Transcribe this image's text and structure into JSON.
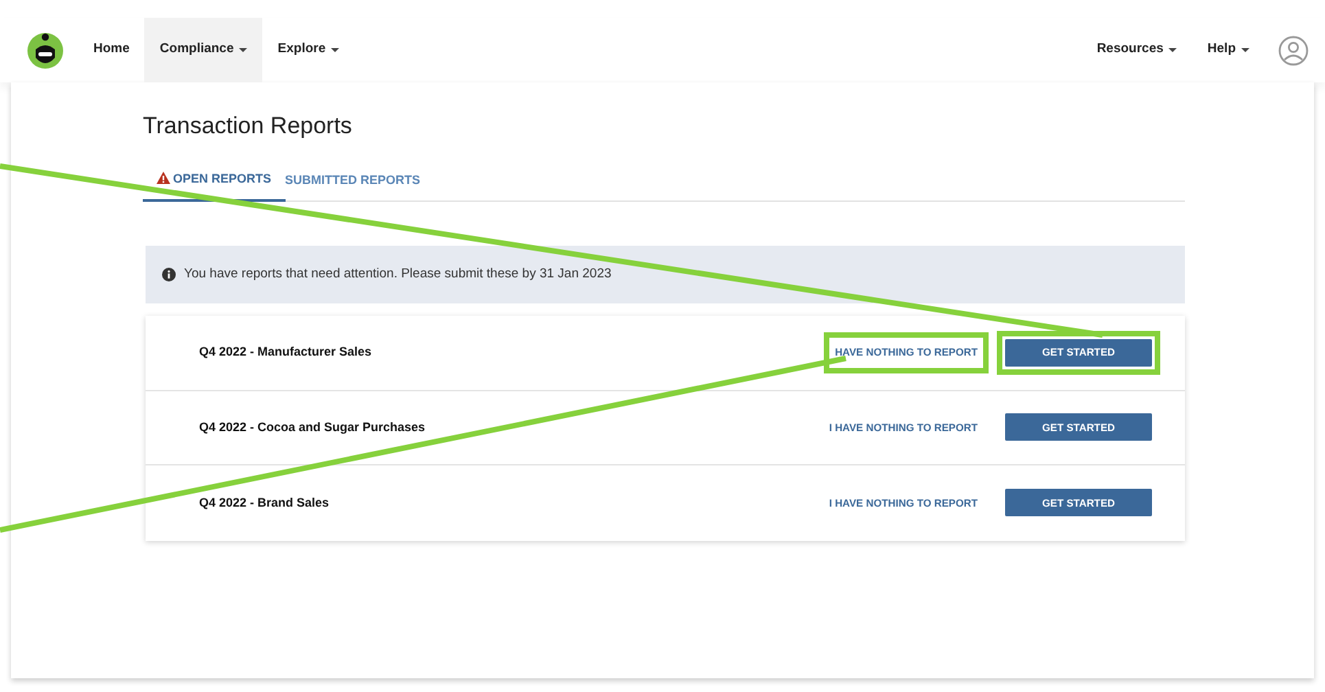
{
  "navbar": {
    "left_items": [
      {
        "label": "Home",
        "dropdown": false,
        "selected": false
      },
      {
        "label": "Compliance",
        "dropdown": true,
        "selected": true
      },
      {
        "label": "Explore",
        "dropdown": true,
        "selected": false
      }
    ],
    "right_items": [
      {
        "label": "Resources",
        "dropdown": true
      },
      {
        "label": "Help",
        "dropdown": true
      }
    ]
  },
  "page_title": "Transaction Reports",
  "tabs": [
    {
      "label": "OPEN REPORTS",
      "selected": true,
      "warning": true
    },
    {
      "label": "SUBMITTED REPORTS",
      "selected": false,
      "warning": false
    }
  ],
  "alert": {
    "text": "You have reports that need attention. Please submit these by 31 Jan 2023"
  },
  "reports": [
    {
      "title": "Q4 2022 - Manufacturer Sales",
      "link": "HAVE NOTHING TO REPORT",
      "button": "GET STARTED",
      "highlighted": true
    },
    {
      "title": "Q4 2022 - Cocoa and Sugar Purchases",
      "link": "I HAVE NOTHING TO REPORT",
      "button": "GET STARTED",
      "highlighted": false
    },
    {
      "title": "Q4 2022 - Brand Sales",
      "link": "I HAVE NOTHING TO REPORT",
      "button": "GET STARTED",
      "highlighted": false
    }
  ]
}
